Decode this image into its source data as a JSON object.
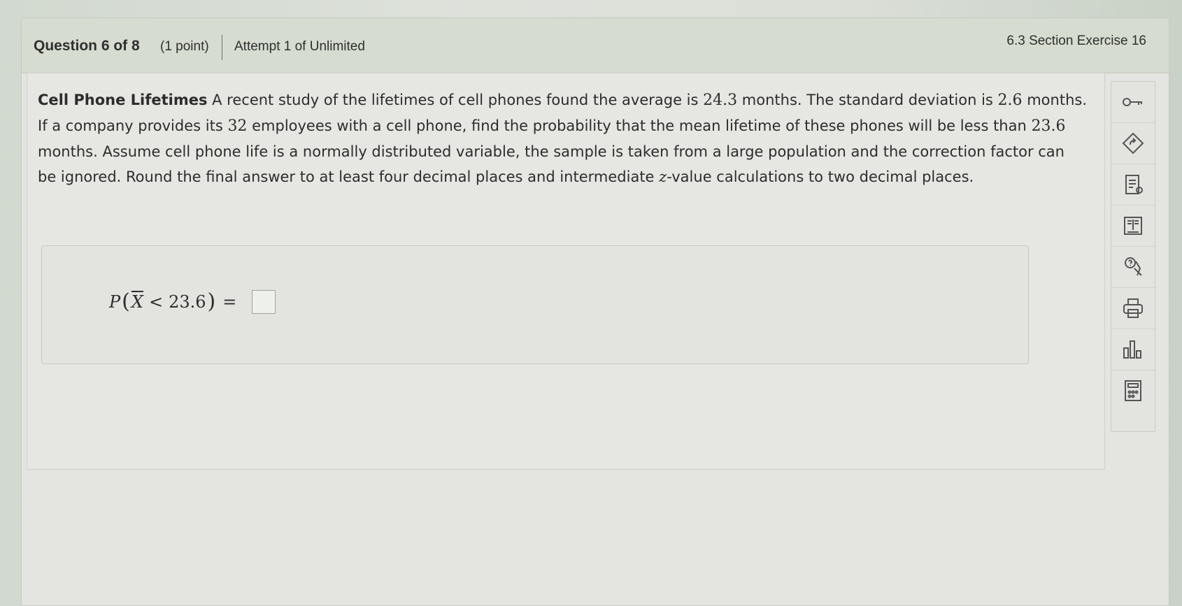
{
  "header": {
    "question_label": "Question 6 of 8",
    "points": "(1 point)",
    "attempt": "Attempt 1 of Unlimited",
    "exercise": "6.3 Section Exercise 16"
  },
  "question": {
    "title": "Cell Phone Lifetimes",
    "s1": " A recent study of the lifetimes of cell phones found the average is ",
    "n1": "24.3",
    "s2": " months. The standard deviation is ",
    "n2": "2.6",
    "s3": " months. If a company provides its ",
    "n3": "32",
    "s4": " employees with a cell phone, find the probability that the mean lifetime of these phones will be less than ",
    "n4": "23.6",
    "s5": " months. Assume cell phone life is a normally distributed variable, the sample is taken from a large population and the correction factor can be ignored. Round the final answer to at least four decimal places and intermediate ",
    "z_var": "z",
    "s6": "-value calculations to two decimal places."
  },
  "answer": {
    "p": "P",
    "open_paren": "(",
    "xbar": "X",
    "lt": "<",
    "value": "23.6",
    "close_paren": ")",
    "eq": "=",
    "input_value": ""
  },
  "tools": [
    "key-icon",
    "hint-icon",
    "notes-icon",
    "book-icon",
    "help-person-icon",
    "print-icon",
    "chart-icon",
    "calculator-icon"
  ]
}
